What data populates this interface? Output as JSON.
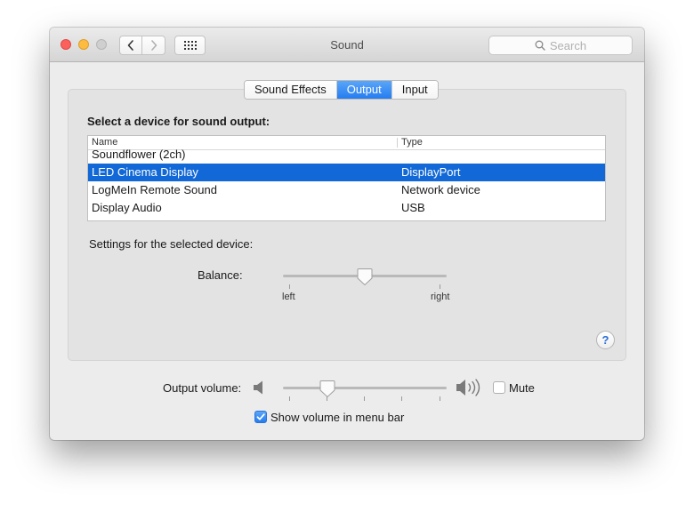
{
  "window": {
    "title": "Sound"
  },
  "search": {
    "placeholder": "Search"
  },
  "tabs": [
    {
      "label": "Sound Effects",
      "active": false
    },
    {
      "label": "Output",
      "active": true
    },
    {
      "label": "Input",
      "active": false
    }
  ],
  "output": {
    "heading": "Select a device for sound output:",
    "columns": {
      "name": "Name",
      "type": "Type"
    },
    "devices": [
      {
        "name": "Soundflower (2ch)",
        "type": "",
        "selected": false
      },
      {
        "name": "LED Cinema Display",
        "type": "DisplayPort",
        "selected": true
      },
      {
        "name": "LogMeIn Remote Sound",
        "type": "Network device",
        "selected": false
      },
      {
        "name": "Display Audio",
        "type": "USB",
        "selected": false
      }
    ],
    "settings_label": "Settings for the selected device:",
    "balance": {
      "label": "Balance:",
      "left_label": "left",
      "right_label": "right",
      "value": 0.5
    },
    "help_label": "?"
  },
  "volume": {
    "label": "Output volume:",
    "value": 0.27,
    "mute_label": "Mute",
    "mute_checked": false,
    "menubar_label": "Show volume in menu bar",
    "menubar_checked": true
  },
  "icons": {
    "back": "chevron-left-icon",
    "forward": "chevron-right-icon",
    "grid": "grid-icon",
    "search": "search-icon",
    "speaker_low": "speaker-low-icon",
    "speaker_high": "speaker-high-icon",
    "help": "help-icon",
    "check": "checkmark-icon"
  },
  "colors": {
    "accent": "#1168d6",
    "tab_active": "#247cf0",
    "close": "#fc605c",
    "minimize": "#fdbc40",
    "zoom_disabled": "#cfcfcf"
  }
}
